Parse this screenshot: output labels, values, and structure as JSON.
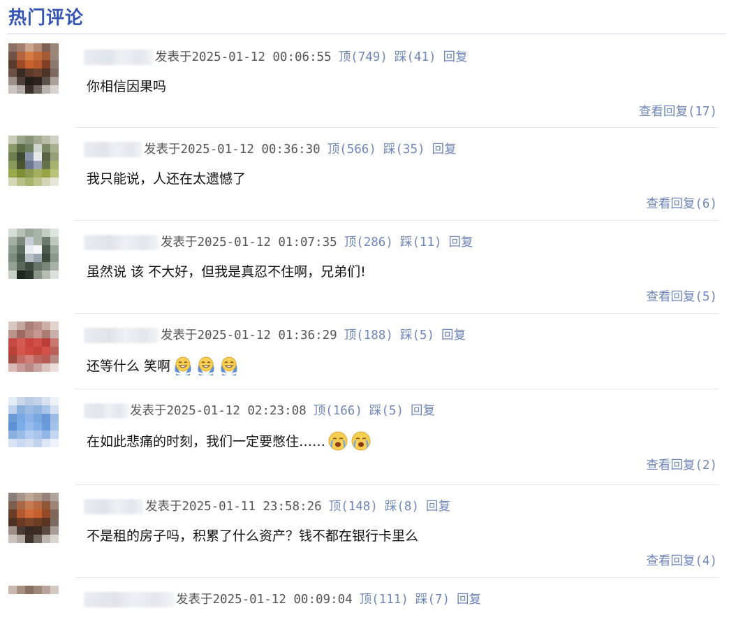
{
  "section": {
    "title": "热门评论"
  },
  "labels": {
    "posted": "发表于",
    "up": "顶",
    "down": "踩",
    "reply": "回复",
    "view_replies": "查看回复"
  },
  "comments": [
    {
      "timestamp": "2025-01-12 00:06:55",
      "up": "749",
      "down": "41",
      "text": "你相信因果吗",
      "emojis": [],
      "replies": "17",
      "avatar_colors": [
        "#8a7266",
        "#a07f6e",
        "#c9a58d",
        "#b08a74",
        "#7d6052",
        "#9a8678",
        "#6e5346",
        "#b4643f",
        "#d47a42",
        "#c2693a",
        "#a45a35",
        "#9c8579",
        "#5a3a2c",
        "#9e4a28",
        "#c8622f",
        "#b85a2d",
        "#7e3f24",
        "#8b786e",
        "#6b5045",
        "#3b2a22",
        "#5c3b2a",
        "#6a4330",
        "#4c3326",
        "#7e6a60",
        "#9d918b",
        "#4d3f3a",
        "#251d1a",
        "#2d231e",
        "#5d514b",
        "#aaa19c",
        "#c9c4c1",
        "#b3aba7",
        "#3a2f2a",
        "#6f6661",
        "#bab4b1",
        "#d6d3d1"
      ]
    },
    {
      "timestamp": "2025-01-12 00:36:30",
      "up": "566",
      "down": "35",
      "text": "我只能说，人还在太遗憾了",
      "emojis": [],
      "replies": "6",
      "avatar_colors": [
        "#c8ccb8",
        "#9aa48a",
        "#8b9479",
        "#a3aa90",
        "#b9bda8",
        "#cfd1c4",
        "#8a9a6a",
        "#5e6d48",
        "#708060",
        "#d0d4cf",
        "#7a8868",
        "#a8b090",
        "#6f7f50",
        "#3e4a34",
        "#8892a6",
        "#e6e8ec",
        "#5a6246",
        "#95a078",
        "#8b9a5a",
        "#4a5530",
        "#6c7690",
        "#9aa2b8",
        "#66724a",
        "#a8b26e",
        "#9aaa4a",
        "#7e8e34",
        "#8c9a52",
        "#a4b060",
        "#96a444",
        "#b8c278",
        "#d4d8b8",
        "#b8c288",
        "#a8b46c",
        "#bcc48c",
        "#d2d6b4",
        "#e4e6d8"
      ]
    },
    {
      "timestamp": "2025-01-12 01:07:35",
      "up": "286",
      "down": "11",
      "text": "虽然说 该 不大好，但我是真忍不住啊，兄弟们!",
      "emojis": [],
      "replies": "5",
      "avatar_colors": [
        "#d8dcd8",
        "#b8c0b8",
        "#9ca89c",
        "#a8b4a8",
        "#c4ccc4",
        "#e0e4e0",
        "#a4b0a4",
        "#7a887c",
        "#c8ccd4",
        "#aab4a8",
        "#6a7a6c",
        "#c0c8c0",
        "#8a9a8c",
        "#5c6c5e",
        "#e8ecf0",
        "#f4f6f8",
        "#4c5a4e",
        "#9aa89c",
        "#7c8c7e",
        "#4a5a4c",
        "#b8c0c8",
        "#9aa4ae",
        "#3c4a3e",
        "#8a988c",
        "#94a296",
        "#5a685c",
        "#404c42",
        "#68746a",
        "#7a887c",
        "#a8b2a8",
        "#c8cec8",
        "#1e2820",
        "#2c362e",
        "#8a948a",
        "#b4bcb4",
        "#dce0dc"
      ]
    },
    {
      "timestamp": "2025-01-12 01:36:29",
      "up": "188",
      "down": "5",
      "text": "还等什么 笑啊",
      "emojis": [
        "laugh-cry",
        "laugh-cry",
        "laugh-cry"
      ],
      "replies": "",
      "avatar_colors": [
        "#d8c8c4",
        "#c4a8a0",
        "#a88078",
        "#b89088",
        "#ccb0a8",
        "#e0d4d0",
        "#b8948c",
        "#9c6a60",
        "#b4847a",
        "#c89890",
        "#aa7c72",
        "#cab0aa",
        "#c44a44",
        "#d45a52",
        "#c8443c",
        "#d05048",
        "#b84038",
        "#c87a72",
        "#b84238",
        "#d4564c",
        "#cc4a42",
        "#c4443a",
        "#d05248",
        "#b8605a",
        "#a04a44",
        "#c46a64",
        "#d08078",
        "#bc6460",
        "#b85a54",
        "#b88a86",
        "#d8b8b4",
        "#c89c98",
        "#b88884",
        "#caa4a0",
        "#dcc4c0",
        "#ecdedc"
      ]
    },
    {
      "timestamp": "2025-01-12 02:23:08",
      "up": "166",
      "down": "5",
      "text": "在如此悲痛的时刻，我们一定要憋住……",
      "emojis": [
        "crying",
        "crying"
      ],
      "replies": "2",
      "avatar_colors": [
        "#e4ecf4",
        "#cad8ea",
        "#b8cce4",
        "#c4d4e8",
        "#d8e2ee",
        "#eef2f8",
        "#c0d2ea",
        "#8cb0dc",
        "#9cbce4",
        "#94b4e0",
        "#a8c4e8",
        "#d4e0f0",
        "#6c9cd8",
        "#7aaae4",
        "#8cb4e8",
        "#78a8e0",
        "#6898d8",
        "#9cbce6",
        "#5c90d4",
        "#7cacea",
        "#94bcec",
        "#84b0e8",
        "#6a9cdc",
        "#a4c2ea",
        "#8ab0e2",
        "#9cbce8",
        "#b4ccee",
        "#a8c4ea",
        "#94b6e4",
        "#c4d6f0",
        "#d8e4f2",
        "#c8d8ee",
        "#d4e0f2",
        "#c0d2ec",
        "#dce6f4",
        "#eef2f8"
      ]
    },
    {
      "timestamp": "2025-01-11 23:58:26",
      "up": "148",
      "down": "8",
      "text": "不是租的房子吗，积累了什么资产？钱不都在银行卡里么",
      "emojis": [],
      "replies": "4",
      "avatar_colors": [
        "#8a7e78",
        "#a89488",
        "#c0a898",
        "#b09888",
        "#968278",
        "#b0a49c",
        "#7a5e50",
        "#a86848",
        "#c87a50",
        "#b86a44",
        "#8e5838",
        "#9c8478",
        "#6a3e28",
        "#b45a32",
        "#d06a38",
        "#c4602e",
        "#944a28",
        "#7e6658",
        "#4e3224",
        "#6a3a22",
        "#7a4428",
        "#6c3c24",
        "#5a3420",
        "#7a6a60",
        "#a09088",
        "#4a3a32",
        "#382a24",
        "#3c2c24",
        "#5a4a42",
        "#a89c96",
        "#cac2be",
        "#b4aaa4",
        "#3e322c",
        "#746a64",
        "#beb6b2",
        "#d8d4d2"
      ]
    },
    {
      "timestamp": "2025-01-12 00:09:04",
      "up": "111",
      "down": "7",
      "text": "",
      "emojis": [],
      "replies": "",
      "avatar_colors": [
        "#c8b8b0",
        "#a89080",
        "#8a7060",
        "#a08878",
        "#b8a49a",
        "#d4c8c2"
      ]
    }
  ]
}
